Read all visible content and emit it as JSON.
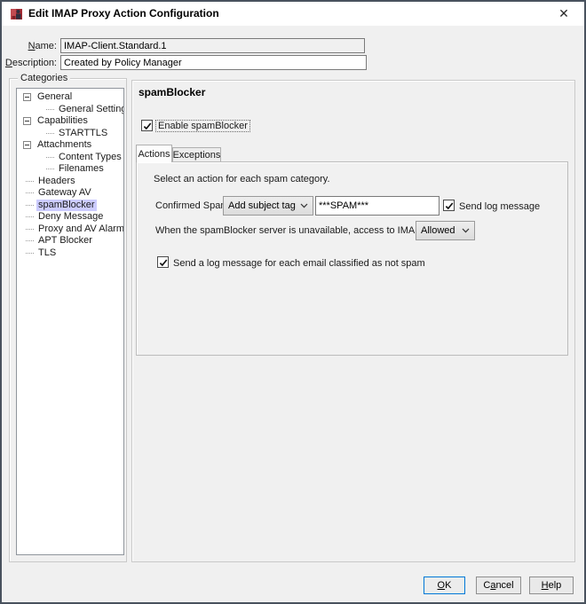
{
  "window": {
    "title": "Edit IMAP Proxy Action Configuration"
  },
  "icons": {
    "close": "✕",
    "tree_collapse": "minus-box",
    "chevron": "chevron-down",
    "check": "check-mark"
  },
  "form": {
    "name_label": "Name:",
    "name_mnemonic": 0,
    "name_value": "IMAP-Client.Standard.1",
    "description_label": "Description:",
    "description_mnemonic": 0,
    "description_value": "Created by Policy Manager"
  },
  "categories": {
    "group_label": "Categories",
    "items": [
      {
        "label": "General",
        "level": 0,
        "expandable": true,
        "selected": false
      },
      {
        "label": "General Settings",
        "level": 1,
        "expandable": false,
        "selected": false
      },
      {
        "label": "Capabilities",
        "level": 0,
        "expandable": true,
        "selected": false
      },
      {
        "label": "STARTTLS",
        "level": 1,
        "expandable": false,
        "selected": false
      },
      {
        "label": "Attachments",
        "level": 0,
        "expandable": true,
        "selected": false
      },
      {
        "label": "Content Types",
        "level": 1,
        "expandable": false,
        "selected": false
      },
      {
        "label": "Filenames",
        "level": 1,
        "expandable": false,
        "selected": false
      },
      {
        "label": "Headers",
        "level": 0,
        "expandable": false,
        "selected": false
      },
      {
        "label": "Gateway AV",
        "level": 0,
        "expandable": false,
        "selected": false
      },
      {
        "label": "spamBlocker",
        "level": 0,
        "expandable": false,
        "selected": true
      },
      {
        "label": "Deny Message",
        "level": 0,
        "expandable": false,
        "selected": false
      },
      {
        "label": "Proxy and AV Alarms",
        "level": 0,
        "expandable": false,
        "selected": false
      },
      {
        "label": "APT Blocker",
        "level": 0,
        "expandable": false,
        "selected": false
      },
      {
        "label": "TLS",
        "level": 0,
        "expandable": false,
        "selected": false
      }
    ]
  },
  "panel": {
    "heading": "spamBlocker",
    "enable_checkbox": {
      "label": "Enable spamBlocker",
      "checked": true
    },
    "tabs": [
      {
        "label": "Actions",
        "active": true
      },
      {
        "label": "Exceptions",
        "active": false
      }
    ],
    "actions_tab": {
      "intro": "Select an action for each spam category.",
      "confirmed_spam": {
        "label": "Confirmed Spam:",
        "action_value": "Add subject tag",
        "tag_value": "***SPAM***",
        "send_log": {
          "label": "Send log message",
          "checked": true
        }
      },
      "unavailable": {
        "label": "When the spamBlocker server is unavailable, access to IMAP email is",
        "value": "Allowed"
      },
      "not_spam_log": {
        "label": "Send a log message for each email classified as not spam",
        "checked": true
      }
    }
  },
  "buttons": {
    "ok": {
      "label": "OK",
      "mnemonic": 0
    },
    "cancel": {
      "label": "Cancel",
      "mnemonic": 1
    },
    "help": {
      "label": "Help",
      "mnemonic": 0
    }
  },
  "colors": {
    "selection": "#ccccff",
    "focus_accent": "#0078d7",
    "titlebar": "#ffffff",
    "dialog_bg": "#f0f0f0"
  }
}
